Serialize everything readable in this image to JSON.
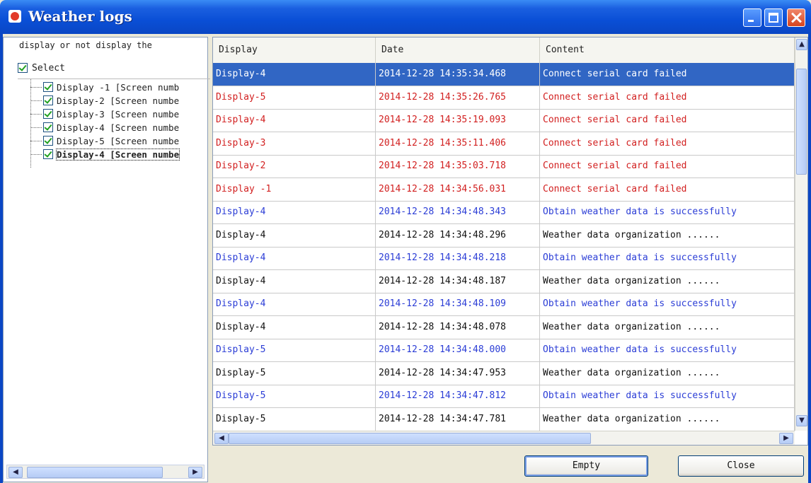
{
  "window": {
    "title": "Weather logs"
  },
  "left_panel": {
    "hint": "display or not display the",
    "select_all_label": "Select",
    "items": [
      {
        "label": "Display -1 [Screen numb",
        "checked": true
      },
      {
        "label": "Display-2 [Screen numbe",
        "checked": true
      },
      {
        "label": "Display-3 [Screen numbe",
        "checked": true
      },
      {
        "label": "Display-4 [Screen numbe",
        "checked": true
      },
      {
        "label": "Display-5 [Screen numbe",
        "checked": true
      },
      {
        "label": "Display-4 [Screen numbe",
        "checked": true
      }
    ]
  },
  "table": {
    "columns": [
      "Display",
      "Date",
      "Content"
    ],
    "rows": [
      {
        "display": "Display-4",
        "date": "2014-12-28 14:35:34.468",
        "content": "Connect serial card failed",
        "style": "selected"
      },
      {
        "display": "Display-5",
        "date": "2014-12-28 14:35:26.765",
        "content": "Connect serial card failed",
        "style": "red"
      },
      {
        "display": "Display-4",
        "date": "2014-12-28 14:35:19.093",
        "content": "Connect serial card failed",
        "style": "red"
      },
      {
        "display": "Display-3",
        "date": "2014-12-28 14:35:11.406",
        "content": "Connect serial card failed",
        "style": "red"
      },
      {
        "display": "Display-2",
        "date": "2014-12-28 14:35:03.718",
        "content": "Connect serial card failed",
        "style": "red"
      },
      {
        "display": "Display -1",
        "date": "2014-12-28 14:34:56.031",
        "content": "Connect serial card failed",
        "style": "red"
      },
      {
        "display": "Display-4",
        "date": "2014-12-28 14:34:48.343",
        "content": "Obtain weather data is successfully",
        "style": "blue"
      },
      {
        "display": "Display-4",
        "date": "2014-12-28 14:34:48.296",
        "content": "Weather data organization ......",
        "style": "black"
      },
      {
        "display": "Display-4",
        "date": "2014-12-28 14:34:48.218",
        "content": "Obtain weather data is successfully",
        "style": "blue"
      },
      {
        "display": "Display-4",
        "date": "2014-12-28 14:34:48.187",
        "content": "Weather data organization ......",
        "style": "black"
      },
      {
        "display": "Display-4",
        "date": "2014-12-28 14:34:48.109",
        "content": "Obtain weather data is successfully",
        "style": "blue"
      },
      {
        "display": "Display-4",
        "date": "2014-12-28 14:34:48.078",
        "content": "Weather data organization ......",
        "style": "black"
      },
      {
        "display": "Display-5",
        "date": "2014-12-28 14:34:48.000",
        "content": "Obtain weather data is successfully",
        "style": "blue"
      },
      {
        "display": "Display-5",
        "date": "2014-12-28 14:34:47.953",
        "content": "Weather data organization ......",
        "style": "black"
      },
      {
        "display": "Display-5",
        "date": "2014-12-28 14:34:47.812",
        "content": "Obtain weather data is successfully",
        "style": "blue"
      },
      {
        "display": "Display-5",
        "date": "2014-12-28 14:34:47.781",
        "content": "Weather data organization ......",
        "style": "black"
      }
    ]
  },
  "buttons": {
    "empty_label": "Empty",
    "close_label": "Close"
  },
  "icons": {
    "scroll_up": "▲",
    "scroll_down": "▼",
    "scroll_left": "◀",
    "scroll_right": "▶"
  },
  "colors": {
    "title_bar": "#0a4fd6",
    "selected_row": "#3166c4",
    "error_text": "#d22020",
    "success_text": "#2b3dd6"
  }
}
